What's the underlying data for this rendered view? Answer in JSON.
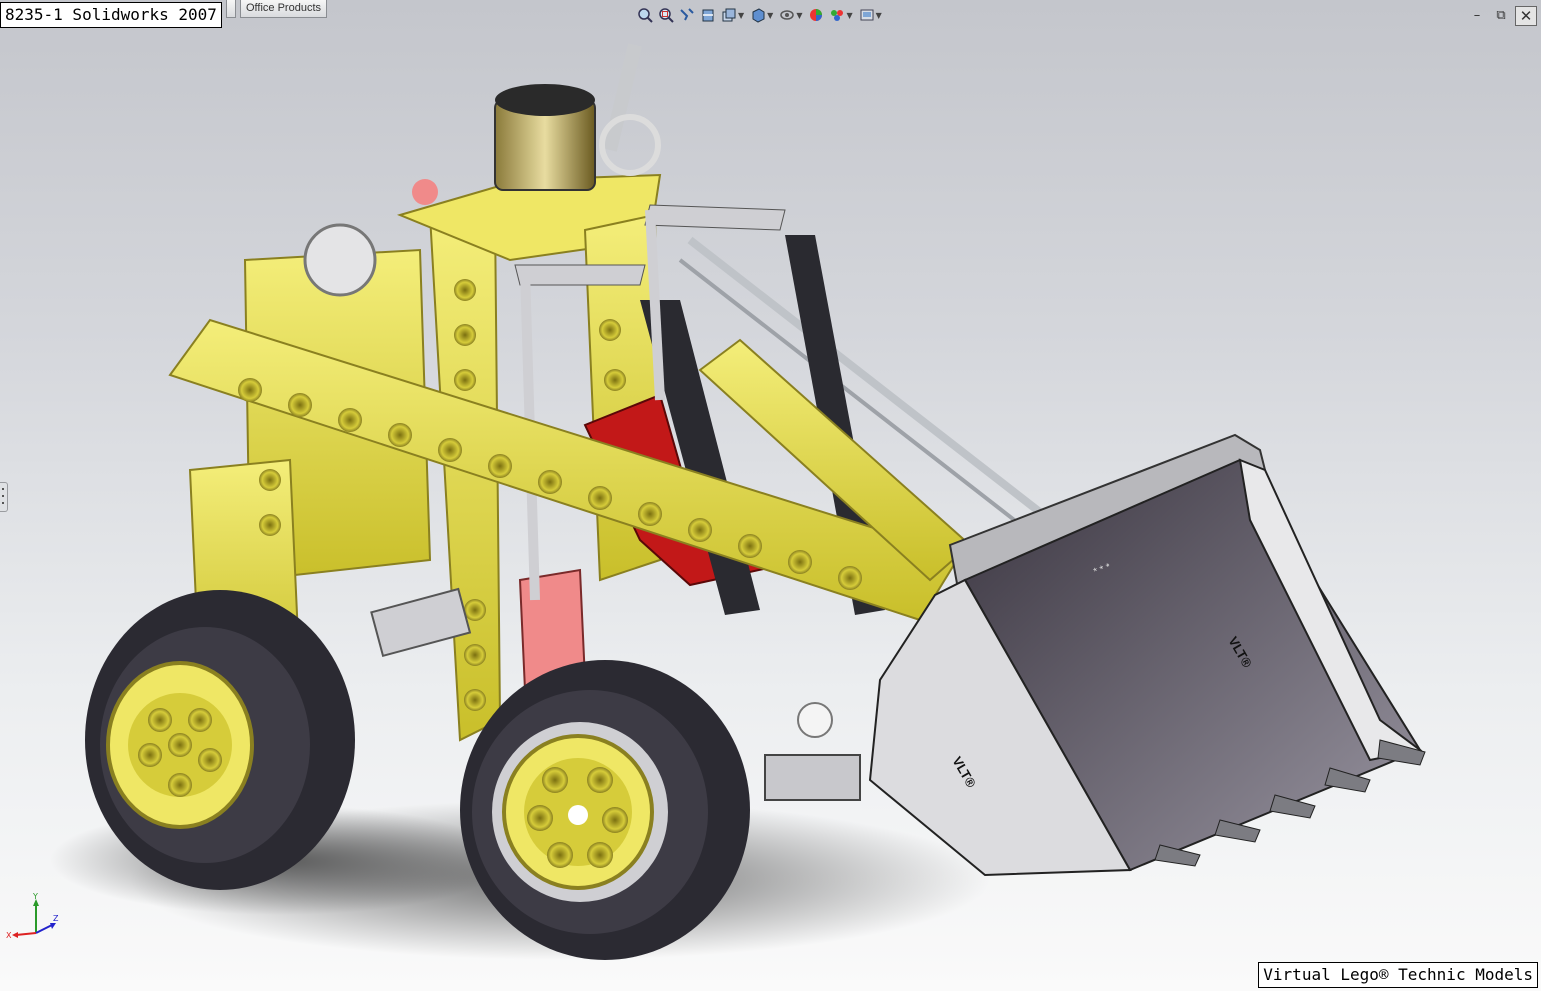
{
  "title": "8235-1 Solidworks 2007",
  "credit": "Virtual Lego® Technic Models",
  "tabs": {
    "office": "Office Products"
  },
  "hud_toolbar": [
    "zoom-to-fit-icon",
    "zoom-area-icon",
    "previous-view-icon",
    "section-view-icon",
    "view-orientation-icon",
    "display-style-icon",
    "hide-show-icon",
    "appearance-icon",
    "scene-icon",
    "view-settings-icon"
  ],
  "window_controls": {
    "minimize": "–",
    "restore": "⧉",
    "close": "✕"
  },
  "triad": {
    "y": "Y",
    "x": "X",
    "z": "Z"
  },
  "decals": {
    "bucket": "VLT®",
    "bucket2": "VLT®",
    "stars": "* * *"
  },
  "colors": {
    "yellow": "#e8e04a",
    "black": "#2a2a30",
    "red": "#c21818",
    "pink": "#f08a8a",
    "grey": "#cfcfd3"
  }
}
